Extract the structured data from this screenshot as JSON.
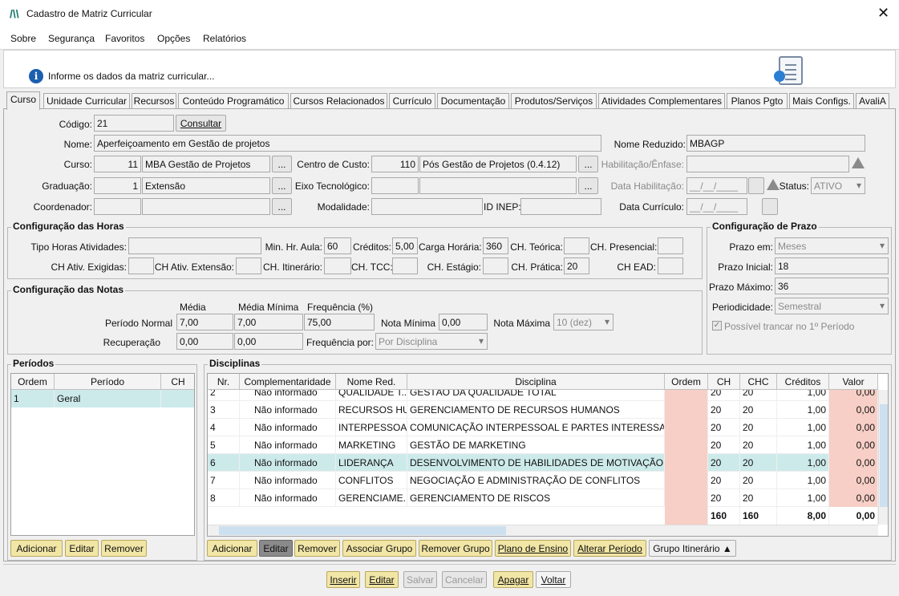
{
  "window": {
    "title": "Cadastro de Matriz Curricular",
    "close": "✕"
  },
  "menu": [
    "Sobre",
    "Segurança",
    "Favoritos",
    "Opções",
    "Relatórios"
  ],
  "info": {
    "icon": "i",
    "text": "Informe os dados da matriz curricular..."
  },
  "tabs": [
    "Curso",
    "Unidade Curricular",
    "Recursos",
    "Conteúdo Programático",
    "Cursos Relacionados",
    "Currículo",
    "Documentação",
    "Produtos/Serviços",
    "Atividades Complementares",
    "Planos Pgto",
    "Mais Configs.",
    "AvaliA"
  ],
  "form": {
    "codigo_label": "Código:",
    "codigo": "21",
    "consultar": "Consultar",
    "nome_label": "Nome:",
    "nome": "Aperfeiçoamento em Gestão de projetos",
    "nome_reduzido_label": "Nome Reduzido:",
    "nome_reduzido": "MBAGP",
    "curso_label": "Curso:",
    "curso_cod": "11",
    "curso_nome": "MBA Gestão de Projetos",
    "centro_label": "Centro de Custo:",
    "centro_cod": "110",
    "centro_nome": "Pós Gestão de Projetos (0.4.12)",
    "habilitacao_label": "Habilitação/Ênfase:",
    "graduacao_label": "Graduação:",
    "graduacao_cod": "1",
    "graduacao_nome": "Extensão",
    "eixo_label": "Eixo Tecnológico:",
    "data_hab_label": "Data Habilitação:",
    "data_hab": "__/__/____",
    "status_label": "Status:",
    "status": "ATIVO",
    "coordenador_label": "Coordenador:",
    "modalidade_label": "Modalidade:",
    "inep_label": "ID INEP:",
    "data_curriculo_label": "Data Currículo:",
    "data_curriculo": "__/__/____",
    "ellipsis": "..."
  },
  "horas": {
    "title": "Configuração das Horas",
    "tipo_label": "Tipo Horas Atividades:",
    "min_label": "Min. Hr. Aula:",
    "min": "60",
    "creditos_label": "Créditos:",
    "creditos": "5,00",
    "carga_label": "Carga Horária:",
    "carga": "360",
    "ch_teorica_label": "CH. Teórica:",
    "ch_presencial_label": "CH. Presencial:",
    "ch_exig_label": "CH Ativ. Exigidas:",
    "ch_ext_label": "CH Ativ. Extensão:",
    "ch_itin_label": "CH. Itinerário:",
    "ch_tcc_label": "CH. TCC:",
    "ch_estagio_label": "CH. Estágio:",
    "ch_pratica_label": "CH. Prática:",
    "ch_pratica": "20",
    "ch_ead_label": "CH EAD:"
  },
  "notas": {
    "title": "Configuração das Notas",
    "media_h": "Média",
    "media_min_h": "Média Mínima",
    "freq_h": "Frequência (%)",
    "periodo_label": "Período Normal",
    "media": "7,00",
    "media_min": "7,00",
    "freq": "75,00",
    "nota_min_label": "Nota Mínima",
    "nota_min": "0,00",
    "nota_max_label": "Nota Máxima",
    "nota_max": "10 (dez)",
    "recup_label": "Recuperação",
    "recup_media": "0,00",
    "recup_media_min": "0,00",
    "freq_por_label": "Frequência por:",
    "freq_por": "Por Disciplina"
  },
  "prazo": {
    "title": "Configuração de Prazo",
    "prazo_em_label": "Prazo em:",
    "prazo_em": "Meses",
    "inicial_label": "Prazo Inicial:",
    "inicial": "18",
    "maximo_label": "Prazo Máximo:",
    "maximo": "36",
    "period_label": "Periodicidade:",
    "period": "Semestral",
    "trancar": "Possível trancar no 1º Período"
  },
  "periodos": {
    "title": "Períodos",
    "headers": [
      "Ordem",
      "Período",
      "CH"
    ],
    "rows": [
      [
        "1",
        "Geral",
        ""
      ]
    ],
    "buttons": [
      "Adicionar",
      "Editar",
      "Remover"
    ]
  },
  "disciplinas": {
    "title": "Disciplinas",
    "headers": [
      "Nr.",
      "Complementaridade",
      "Nome Red.",
      "Disciplina",
      "Ordem",
      "CH",
      "CHC",
      "Créditos",
      "Valor"
    ],
    "rows": [
      [
        "2",
        "Não informado",
        "QUALIDADE T...",
        "GESTÃO DA QUALIDADE TOTAL",
        "",
        "20",
        "20",
        "1,00",
        "0,00"
      ],
      [
        "3",
        "Não informado",
        "RECURSOS HU...",
        "GERENCIAMENTO DE RECURSOS HUMANOS",
        "",
        "20",
        "20",
        "1,00",
        "0,00"
      ],
      [
        "4",
        "Não informado",
        "INTERPESSOAL",
        "COMUNICAÇÃO INTERPESSOAL E PARTES INTERESSADAS",
        "",
        "20",
        "20",
        "1,00",
        "0,00"
      ],
      [
        "5",
        "Não informado",
        "MARKETING",
        "GESTÃO DE MARKETING",
        "",
        "20",
        "20",
        "1,00",
        "0,00"
      ],
      [
        "6",
        "Não informado",
        "LIDERANÇA",
        "DESENVOLVIMENTO DE HABILIDADES DE MOTIVAÇÃO E LIDERANÇA",
        "",
        "20",
        "20",
        "1,00",
        "0,00"
      ],
      [
        "7",
        "Não informado",
        "CONFLITOS",
        "NEGOCIAÇÃO E ADMINISTRAÇÃO DE CONFLITOS",
        "",
        "20",
        "20",
        "1,00",
        "0,00"
      ],
      [
        "8",
        "Não informado",
        "GERENCIAME...",
        "GERENCIAMENTO DE RISCOS",
        "",
        "20",
        "20",
        "1,00",
        "0,00"
      ]
    ],
    "totals": {
      "ch": "160",
      "chc": "160",
      "creditos": "8,00",
      "valor": "0,00"
    },
    "buttons": [
      "Adicionar",
      "Editar",
      "Remover",
      "Associar Grupo",
      "Remover Grupo",
      "Plano de Ensino",
      "Alterar Período",
      "Grupo Itinerário"
    ]
  },
  "footer": [
    "Inserir",
    "Editar",
    "Salvar",
    "Cancelar",
    "Apagar",
    "Voltar"
  ]
}
